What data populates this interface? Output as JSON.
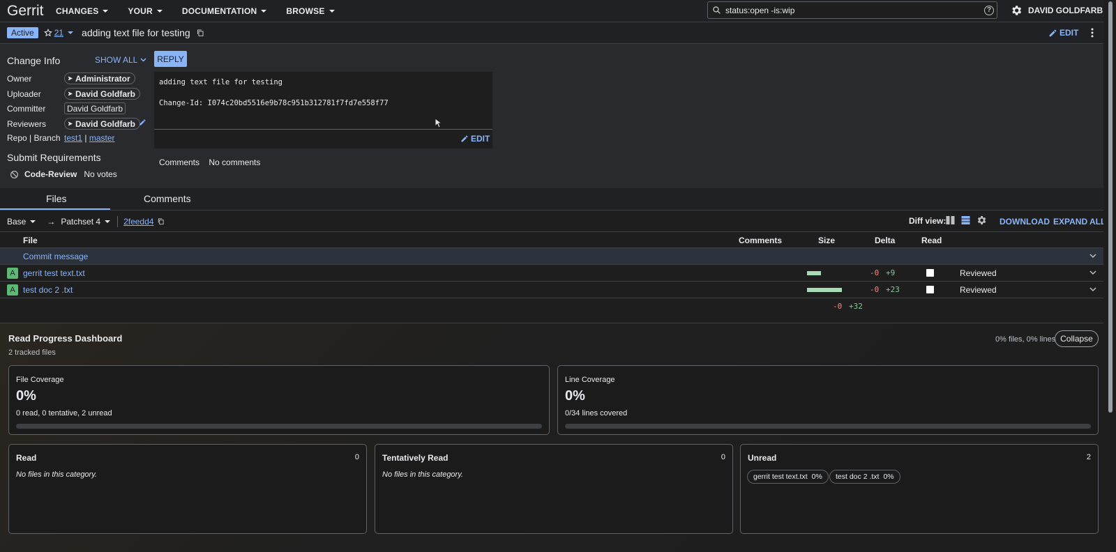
{
  "header": {
    "logo": "Gerrit",
    "nav": [
      {
        "label": "CHANGES"
      },
      {
        "label": "YOUR"
      },
      {
        "label": "DOCUMENTATION"
      },
      {
        "label": "BROWSE"
      }
    ],
    "search_value": "status:open -is:wip",
    "user": "DAVID GOLDFARB"
  },
  "change": {
    "status": "Active",
    "star_count": "21",
    "title": "adding text file for testing",
    "edit_label": "EDIT"
  },
  "info": {
    "title": "Change Info",
    "show_all": "SHOW ALL",
    "labels": {
      "owner": "Owner",
      "uploader": "Uploader",
      "committer": "Committer",
      "reviewers": "Reviewers",
      "repo_branch": "Repo | Branch"
    },
    "owner": "Administrator",
    "uploader": "David Goldfarb",
    "committer": "David Goldfarb",
    "reviewer": "David Goldfarb",
    "repo": "test1",
    "separator": "|",
    "branch": "master",
    "submit_title": "Submit Requirements",
    "requirement_name": "Code-Review",
    "requirement_status": "No votes"
  },
  "commit": {
    "reply_label": "REPLY",
    "message": "adding text file for testing\n\nChange-Id: I074c20bd5516e9b78c951b312781f7fd7e558f77",
    "edit_label": "EDIT",
    "comments_label": "Comments",
    "comments_value": "No comments"
  },
  "tabs": [
    {
      "label": "Files"
    },
    {
      "label": "Comments"
    }
  ],
  "patchset": {
    "base": "Base",
    "arrow": "→",
    "patchset": "Patchset 4",
    "sha": "2feedd4",
    "diff_view_label": "Diff view:",
    "download": "DOWNLOAD",
    "expand_all": "EXPAND ALL"
  },
  "files_table": {
    "headers": {
      "file": "File",
      "comments": "Comments",
      "size": "Size",
      "delta": "Delta",
      "read": "Read"
    },
    "commit_message": "Commit message",
    "rows": [
      {
        "status": "A",
        "name": "gerrit test text.txt",
        "minus": "-0",
        "plus": "+9",
        "size_fraction": 0.39,
        "read_state": "Reviewed"
      },
      {
        "status": "A",
        "name": "test doc 2 .txt",
        "minus": "-0",
        "plus": "+23",
        "size_fraction": 1.0,
        "read_state": "Reviewed"
      }
    ],
    "total_minus": "-0",
    "total_plus": "+32"
  },
  "dashboard": {
    "title": "Read Progress Dashboard",
    "subtitle": "2 tracked files",
    "summary": "0% files, 0% lines",
    "collapse": "Collapse",
    "file_coverage": {
      "title": "File Coverage",
      "value": "0%",
      "note": "0 read, 0 tentative, 2 unread",
      "fraction": 0
    },
    "line_coverage": {
      "title": "Line Coverage",
      "value": "0%",
      "note": "0/34 lines covered",
      "fraction": 0
    },
    "categories": [
      {
        "title": "Read",
        "count": "0",
        "empty": "No files in this category."
      },
      {
        "title": "Tentatively Read",
        "count": "0",
        "empty": "No files in this category."
      },
      {
        "title": "Unread",
        "count": "2",
        "empty": ""
      }
    ],
    "unread_files": [
      {
        "name": "gerrit test text.txt",
        "pct": "0%"
      },
      {
        "name": "test doc 2 .txt",
        "pct": "0%"
      }
    ]
  },
  "colors": {
    "accent": "#8ab4f8",
    "added": "#5bb974",
    "minus": "#f28b82",
    "plus": "#81c995"
  }
}
